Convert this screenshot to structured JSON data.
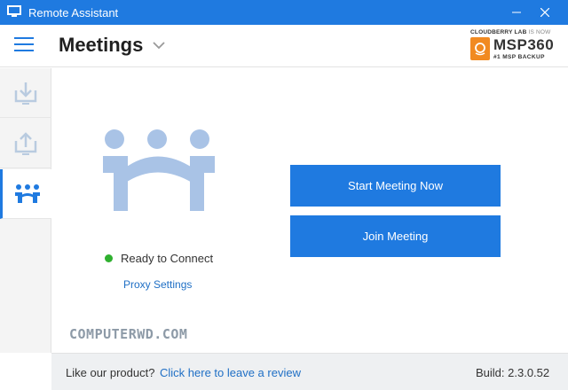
{
  "window": {
    "title": "Remote Assistant",
    "icon": "monitor-icon"
  },
  "header": {
    "page_title": "Meetings",
    "menu_icon": "hamburger-icon",
    "dropdown_icon": "chevron-down-icon"
  },
  "brand": {
    "company": "CLOUDBERRY LAB",
    "is_now": "IS NOW",
    "product": "MSP360",
    "tagline": "#1 MSP BACKUP",
    "accent_color": "#f18a21"
  },
  "sidebar": {
    "items": [
      {
        "name": "download",
        "icon": "download-icon",
        "active": false
      },
      {
        "name": "upload",
        "icon": "upload-icon",
        "active": false
      },
      {
        "name": "meetings",
        "icon": "meetings-icon",
        "active": true
      }
    ]
  },
  "main": {
    "illustration_icon": "people-holding-hands-icon",
    "status_text": "Ready to Connect",
    "status_color": "#2fb02f",
    "proxy_link": "Proxy Settings",
    "start_button": "Start Meeting Now",
    "join_button": "Join Meeting",
    "watermark": "COMPUTERWD.COM"
  },
  "footer": {
    "prompt": "Like our product?",
    "review_link": "Click here to leave a review",
    "build": "Build: 2.3.0.52"
  },
  "colors": {
    "accent": "#1f7ae0",
    "illustration": "#a9c3e6"
  }
}
